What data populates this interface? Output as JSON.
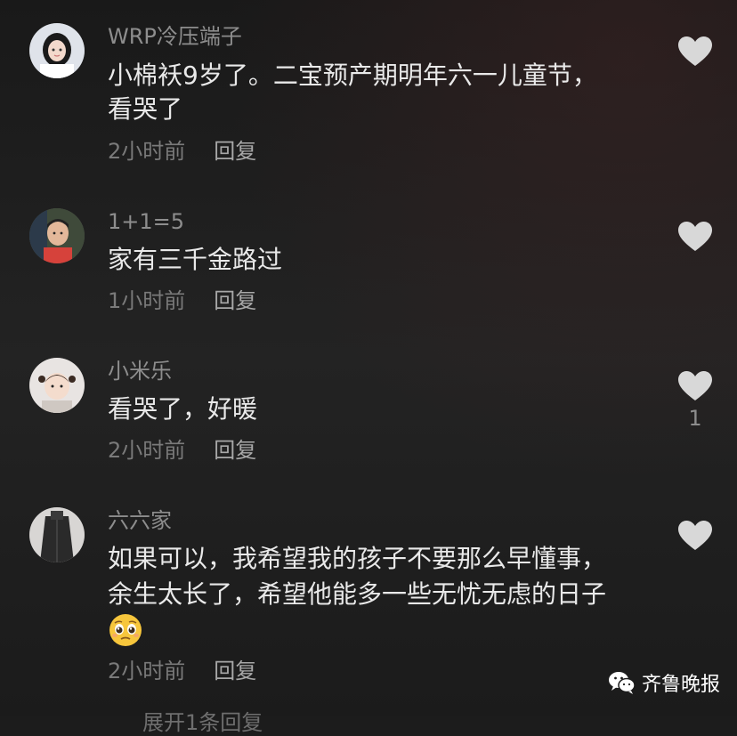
{
  "colors": {
    "background": "#1c1c1c",
    "username": "#8d8d8d",
    "text": "#e9e9e9",
    "meta": "#7a7a7a",
    "reply": "#a8a8a8",
    "heart": "#d8d8d8"
  },
  "comments": [
    {
      "username": "WRP冷压端子",
      "text_lines": [
        "小棉袄9岁了。二宝预产期明年六一儿童节，",
        "看哭了"
      ],
      "time": "2小时前",
      "reply_label": "回复",
      "like_icon": "heart-icon",
      "like_count": ""
    },
    {
      "username": "1+1=5",
      "text_lines": [
        "家有三千金路过"
      ],
      "time": "1小时前",
      "reply_label": "回复",
      "like_icon": "heart-icon",
      "like_count": ""
    },
    {
      "username": "小米乐",
      "text_lines": [
        "看哭了，好暖"
      ],
      "time": "2小时前",
      "reply_label": "回复",
      "like_icon": "heart-icon",
      "like_count": "1"
    },
    {
      "username": "六六家",
      "text_lines": [
        "如果可以，我希望我的孩子不要那么早懂事，",
        "余生太长了，希望他能多一些无忧无虑的日子"
      ],
      "emoji": "pleading-face-emoji",
      "time": "2小时前",
      "reply_label": "回复",
      "like_icon": "heart-icon",
      "like_count": ""
    }
  ],
  "watermark": {
    "icon": "wechat-icon",
    "text": "齐鲁晚报"
  },
  "partial_line": "展开1条回复"
}
